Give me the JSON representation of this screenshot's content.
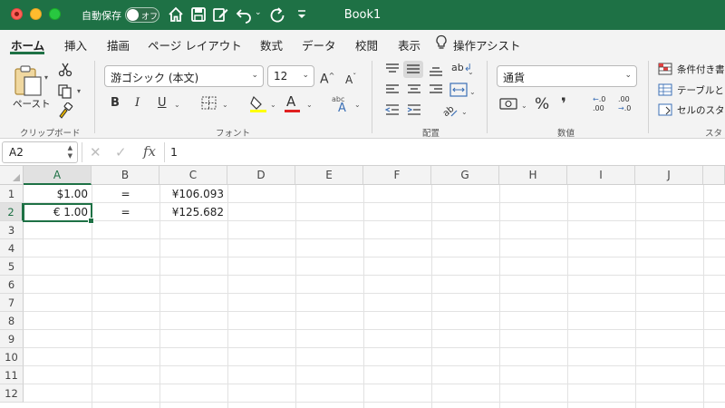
{
  "window": {
    "title": "Book1",
    "autosave_label": "自動保存",
    "autosave_state": "オフ"
  },
  "tabs": [
    "ホーム",
    "挿入",
    "描画",
    "ページ レイアウト",
    "数式",
    "データ",
    "校閲",
    "表示",
    "操作アシスト"
  ],
  "active_tab": "ホーム",
  "ribbon": {
    "clipboard": {
      "paste_label": "ペースト",
      "group_label": "クリップボード"
    },
    "font": {
      "font_name": "游ゴシック (本文)",
      "font_size": "12",
      "bold": "B",
      "italic": "I",
      "underline": "U",
      "font_color_glyph": "A",
      "grow_font_glyph": "A",
      "shrink_font_glyph": "A",
      "phonetic_glyph": "abc",
      "group_label": "フォント",
      "font_color": "#e02020",
      "highlight_color": "#ffff00"
    },
    "alignment": {
      "wrap_glyph": "ab",
      "group_label": "配置"
    },
    "number": {
      "format": "通貨",
      "percent": "%",
      "comma": "❜",
      "increase_decimal": ".00",
      "decrease_decimal": ".00",
      "group_label": "数値"
    },
    "styles": {
      "items": [
        "条件付き書式",
        "テーブルとし",
        "セルのスタイ"
      ],
      "group_label": "スタ"
    }
  },
  "formula_bar": {
    "name_box": "A2",
    "fx": "fx",
    "value": "1"
  },
  "sheet": {
    "columns": [
      "A",
      "B",
      "C",
      "D",
      "E",
      "F",
      "G",
      "H",
      "I",
      "J"
    ],
    "rows": [
      "1",
      "2",
      "3",
      "4",
      "5",
      "6",
      "7",
      "8",
      "9",
      "10",
      "11",
      "12"
    ],
    "selected_cell": "A2",
    "cells": {
      "A1": "$1.00",
      "B1": "=",
      "C1": "¥106.093",
      "A2": "€ 1.00",
      "B2": "=",
      "C2": "¥125.682"
    },
    "accent_color": "#1e7145"
  }
}
